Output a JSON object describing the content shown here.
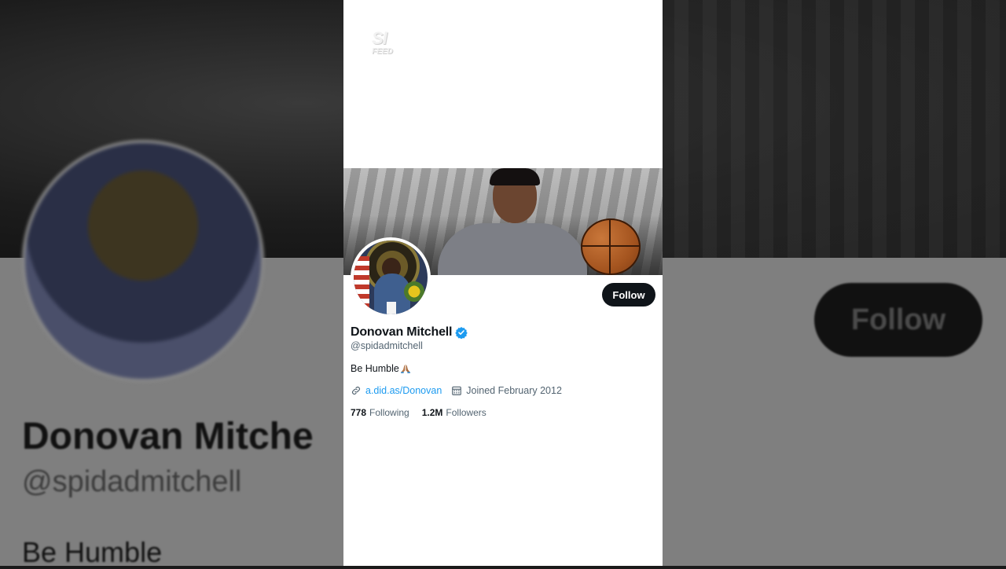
{
  "background": {
    "name": "Donovan Mitche",
    "handle": "@spidadmitchell",
    "bio": "Be Humble",
    "follow_label": "Follow"
  },
  "logo": {
    "line1": "SI",
    "line2": "FEED"
  },
  "profile": {
    "name": "Donovan Mitchell",
    "handle": "@spidadmitchell",
    "bio": "Be Humble",
    "bio_emoji_icon": "folded-hands-icon",
    "link": "a.did.as/Donovan",
    "joined": "Joined February 2012",
    "following_count": "778",
    "following_label": "Following",
    "followers_count": "1.2M",
    "followers_label": "Followers",
    "verified_color": "#1d9bf0"
  },
  "actions": {
    "follow_label": "Follow"
  }
}
